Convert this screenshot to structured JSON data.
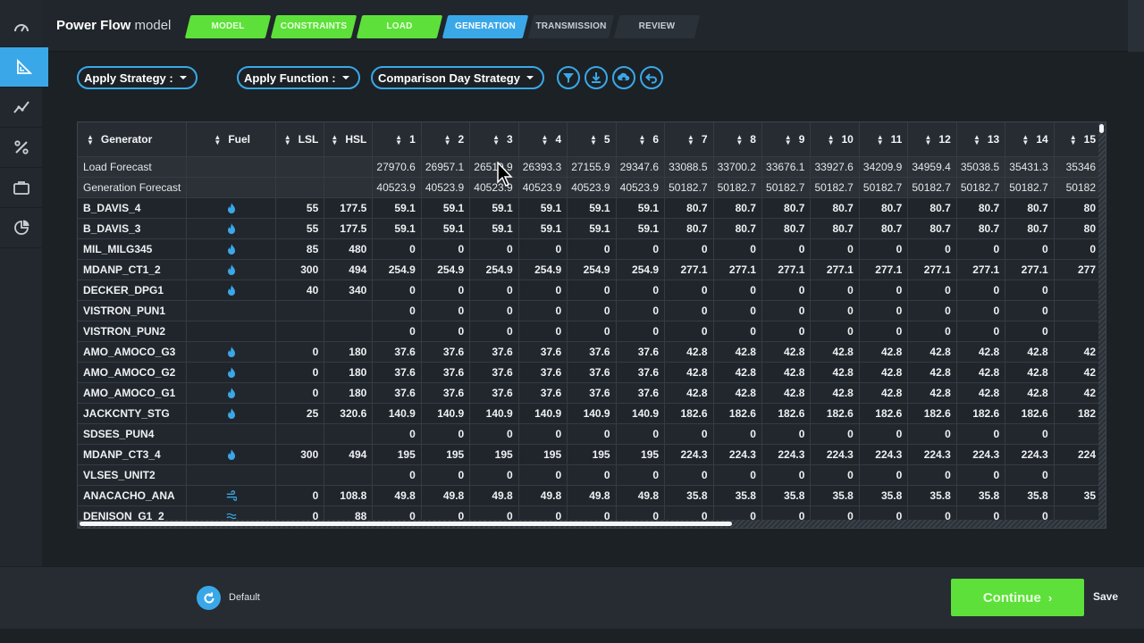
{
  "app": {
    "brand_bold": "Power Flow",
    "brand_rest": "model"
  },
  "steps": [
    {
      "label": "MODEL",
      "state": "done"
    },
    {
      "label": "CONSTRAINTS",
      "state": "done"
    },
    {
      "label": "LOAD",
      "state": "done"
    },
    {
      "label": "GENERATION",
      "state": "active"
    },
    {
      "label": "TRANSMISSION",
      "state": "todo"
    },
    {
      "label": "REVIEW",
      "state": "todo"
    }
  ],
  "rail_icons": [
    "gauge-icon",
    "ruler-triangle-icon",
    "trend-line-icon",
    "percent-icon",
    "briefcase-icon",
    "pie-chart-icon"
  ],
  "toolbar": {
    "apply_strategy": "Apply Strategy :",
    "apply_function": "Apply Function :",
    "comparison": "Comparison Day Strategy",
    "icons": [
      "filter-icon",
      "download-icon",
      "upload-cloud-icon",
      "undo-icon"
    ]
  },
  "table": {
    "headers": [
      "Generator",
      "Fuel",
      "LSL",
      "HSL",
      "1",
      "2",
      "3",
      "4",
      "5",
      "6",
      "7",
      "8",
      "9",
      "10",
      "11",
      "12",
      "13",
      "14",
      "15"
    ],
    "forecast_rows": [
      {
        "name": "Load Forecast",
        "values": [
          "27970.6",
          "26957.1",
          "26510.9",
          "26393.3",
          "27155.9",
          "29347.6",
          "33088.5",
          "33700.2",
          "33676.1",
          "33927.6",
          "34209.9",
          "34959.4",
          "35038.5",
          "35431.3",
          "35346"
        ]
      },
      {
        "name": "Generation Forecast",
        "values": [
          "40523.9",
          "40523.9",
          "40523.9",
          "40523.9",
          "40523.9",
          "40523.9",
          "50182.7",
          "50182.7",
          "50182.7",
          "50182.7",
          "50182.7",
          "50182.7",
          "50182.7",
          "50182.7",
          "50182"
        ]
      }
    ],
    "rows": [
      {
        "name": "B_DAVIS_4",
        "fuel": "flame",
        "lsl": "55",
        "hsl": "177.5",
        "values": [
          "59.1",
          "59.1",
          "59.1",
          "59.1",
          "59.1",
          "59.1",
          "80.7",
          "80.7",
          "80.7",
          "80.7",
          "80.7",
          "80.7",
          "80.7",
          "80.7",
          "80"
        ]
      },
      {
        "name": "B_DAVIS_3",
        "fuel": "flame",
        "lsl": "55",
        "hsl": "177.5",
        "values": [
          "59.1",
          "59.1",
          "59.1",
          "59.1",
          "59.1",
          "59.1",
          "80.7",
          "80.7",
          "80.7",
          "80.7",
          "80.7",
          "80.7",
          "80.7",
          "80.7",
          "80"
        ]
      },
      {
        "name": "MIL_MILG345",
        "fuel": "flame",
        "lsl": "85",
        "hsl": "480",
        "values": [
          "0",
          "0",
          "0",
          "0",
          "0",
          "0",
          "0",
          "0",
          "0",
          "0",
          "0",
          "0",
          "0",
          "0",
          "0"
        ]
      },
      {
        "name": "MDANP_CT1_2",
        "fuel": "flame",
        "lsl": "300",
        "hsl": "494",
        "values": [
          "254.9",
          "254.9",
          "254.9",
          "254.9",
          "254.9",
          "254.9",
          "277.1",
          "277.1",
          "277.1",
          "277.1",
          "277.1",
          "277.1",
          "277.1",
          "277.1",
          "277"
        ]
      },
      {
        "name": "DECKER_DPG1",
        "fuel": "flame",
        "lsl": "40",
        "hsl": "340",
        "values": [
          "0",
          "0",
          "0",
          "0",
          "0",
          "0",
          "0",
          "0",
          "0",
          "0",
          "0",
          "0",
          "0",
          "0",
          ""
        ]
      },
      {
        "name": "VISTRON_PUN1",
        "fuel": "",
        "lsl": "",
        "hsl": "",
        "values": [
          "0",
          "0",
          "0",
          "0",
          "0",
          "0",
          "0",
          "0",
          "0",
          "0",
          "0",
          "0",
          "0",
          "0",
          ""
        ]
      },
      {
        "name": "VISTRON_PUN2",
        "fuel": "",
        "lsl": "",
        "hsl": "",
        "values": [
          "0",
          "0",
          "0",
          "0",
          "0",
          "0",
          "0",
          "0",
          "0",
          "0",
          "0",
          "0",
          "0",
          "0",
          ""
        ]
      },
      {
        "name": "AMO_AMOCO_G3",
        "fuel": "flame",
        "lsl": "0",
        "hsl": "180",
        "values": [
          "37.6",
          "37.6",
          "37.6",
          "37.6",
          "37.6",
          "37.6",
          "42.8",
          "42.8",
          "42.8",
          "42.8",
          "42.8",
          "42.8",
          "42.8",
          "42.8",
          "42"
        ]
      },
      {
        "name": "AMO_AMOCO_G2",
        "fuel": "flame",
        "lsl": "0",
        "hsl": "180",
        "values": [
          "37.6",
          "37.6",
          "37.6",
          "37.6",
          "37.6",
          "37.6",
          "42.8",
          "42.8",
          "42.8",
          "42.8",
          "42.8",
          "42.8",
          "42.8",
          "42.8",
          "42"
        ]
      },
      {
        "name": "AMO_AMOCO_G1",
        "fuel": "flame",
        "lsl": "0",
        "hsl": "180",
        "values": [
          "37.6",
          "37.6",
          "37.6",
          "37.6",
          "37.6",
          "37.6",
          "42.8",
          "42.8",
          "42.8",
          "42.8",
          "42.8",
          "42.8",
          "42.8",
          "42.8",
          "42"
        ]
      },
      {
        "name": "JACKCNTY_STG",
        "fuel": "flame",
        "lsl": "25",
        "hsl": "320.6",
        "values": [
          "140.9",
          "140.9",
          "140.9",
          "140.9",
          "140.9",
          "140.9",
          "182.6",
          "182.6",
          "182.6",
          "182.6",
          "182.6",
          "182.6",
          "182.6",
          "182.6",
          "182"
        ]
      },
      {
        "name": "SDSES_PUN4",
        "fuel": "",
        "lsl": "",
        "hsl": "",
        "values": [
          "0",
          "0",
          "0",
          "0",
          "0",
          "0",
          "0",
          "0",
          "0",
          "0",
          "0",
          "0",
          "0",
          "0",
          ""
        ]
      },
      {
        "name": "MDANP_CT3_4",
        "fuel": "flame",
        "lsl": "300",
        "hsl": "494",
        "values": [
          "195",
          "195",
          "195",
          "195",
          "195",
          "195",
          "224.3",
          "224.3",
          "224.3",
          "224.3",
          "224.3",
          "224.3",
          "224.3",
          "224.3",
          "224"
        ]
      },
      {
        "name": "VLSES_UNIT2",
        "fuel": "",
        "lsl": "",
        "hsl": "",
        "values": [
          "0",
          "0",
          "0",
          "0",
          "0",
          "0",
          "0",
          "0",
          "0",
          "0",
          "0",
          "0",
          "0",
          "0",
          ""
        ]
      },
      {
        "name": "ANACACHO_ANA",
        "fuel": "wind",
        "lsl": "0",
        "hsl": "108.8",
        "values": [
          "49.8",
          "49.8",
          "49.8",
          "49.8",
          "49.8",
          "49.8",
          "35.8",
          "35.8",
          "35.8",
          "35.8",
          "35.8",
          "35.8",
          "35.8",
          "35.8",
          "35"
        ]
      },
      {
        "name": "DENISON_G1_2",
        "fuel": "water",
        "lsl": "0",
        "hsl": "88",
        "values": [
          "0",
          "0",
          "0",
          "0",
          "0",
          "0",
          "0",
          "0",
          "0",
          "0",
          "0",
          "0",
          "0",
          "0",
          ""
        ]
      }
    ]
  },
  "footer": {
    "default_label": "Default",
    "continue_label": "Continue",
    "save_label": "Save"
  },
  "colors": {
    "accent": "#3aa8e8",
    "success": "#5de03a",
    "background": "#1c2126"
  }
}
